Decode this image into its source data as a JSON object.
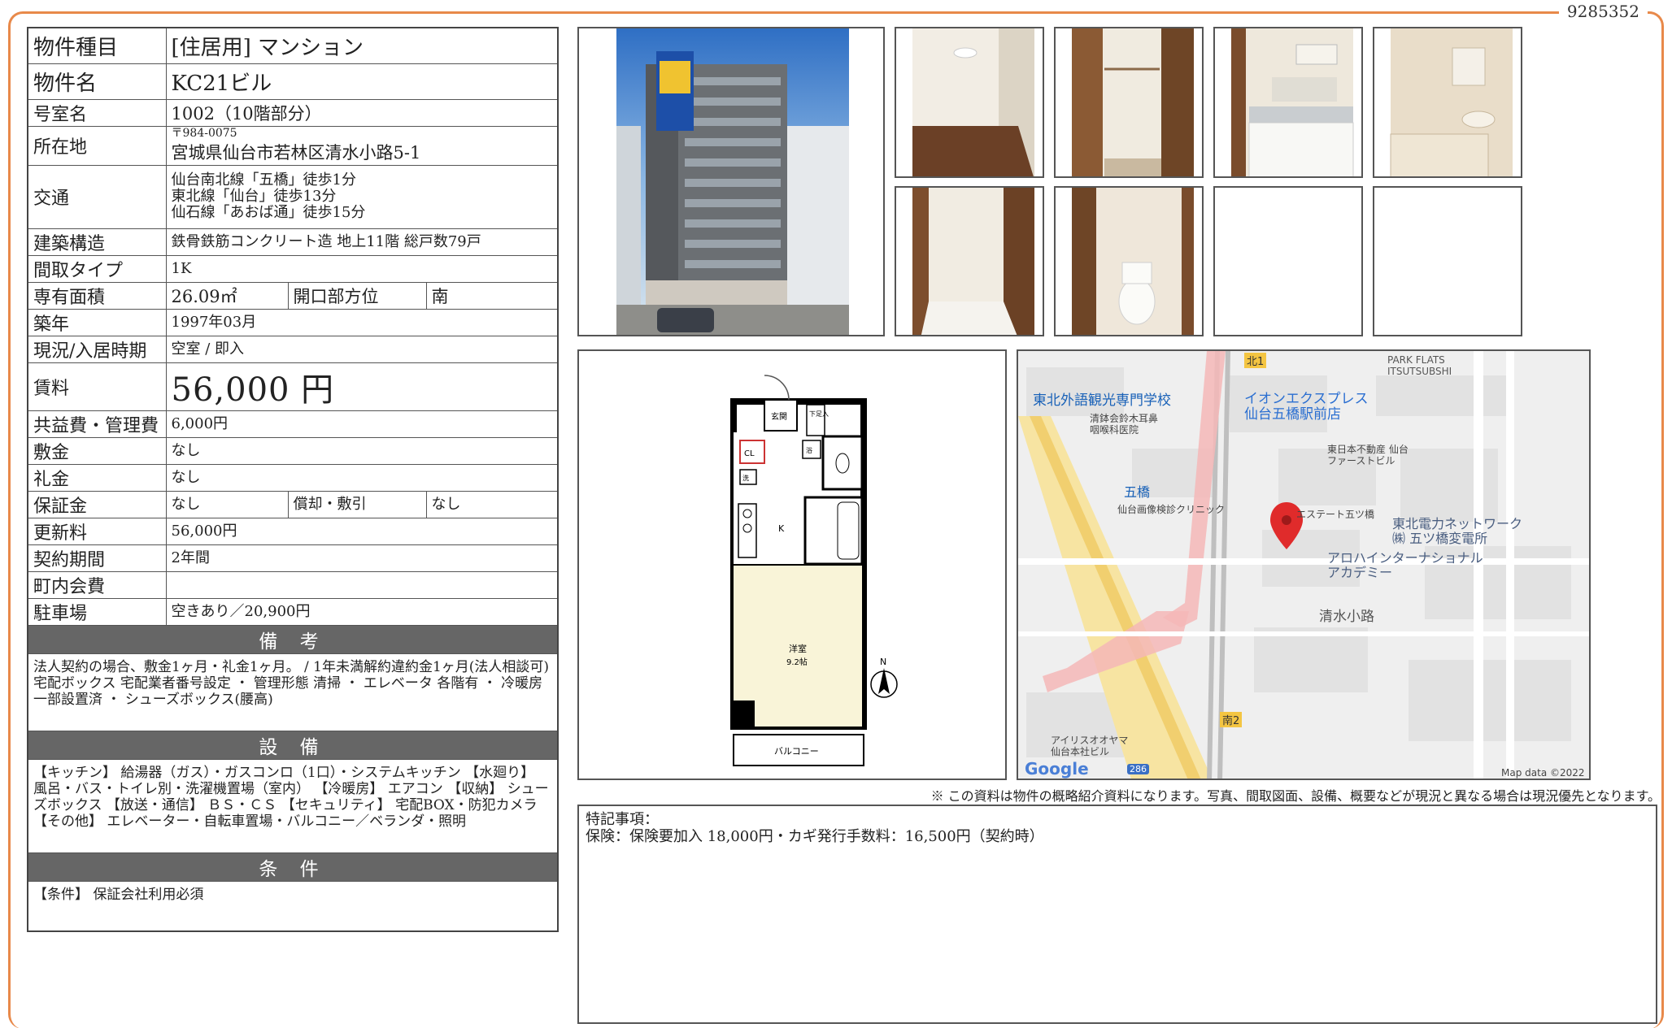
{
  "doc_number": "9285352",
  "property": {
    "type_label": "物件種目",
    "type_value": "[住居用] マンション",
    "name_label": "物件名",
    "name_value": "KC21ビル",
    "room_label": "号室名",
    "room_value": "1002（10階部分）",
    "address_label": "所在地",
    "postal": "〒984-0075",
    "address": "宮城県仙台市若林区清水小路5-1",
    "transport_label": "交通",
    "transport": [
      "仙台南北線「五橋」徒歩1分",
      "東北線「仙台」徒歩13分",
      "仙石線「あおば通」徒歩15分"
    ],
    "structure_label": "建築構造",
    "structure_value": "鉄骨鉄筋コンクリート造 地上11階 総戸数79戸",
    "layout_label": "間取タイプ",
    "layout_value": "1K",
    "area_label": "専有面積",
    "area_value": "26.09㎡",
    "direction_label": "開口部方位",
    "direction_value": "南",
    "built_label": "築年",
    "built_value": "1997年03月",
    "status_label": "現況/入居時期",
    "status_value": "空室 / 即入",
    "rent_label": "賃料",
    "rent_value": "56,000 円",
    "fee_label": "共益費・管理費",
    "fee_value": "6,000円",
    "deposit_label": "敷金",
    "deposit_value": "なし",
    "key_money_label": "礼金",
    "key_money_value": "なし",
    "guarantee_label": "保証金",
    "guarantee_value": "なし",
    "amort_label": "償却・敷引",
    "amort_value": "なし",
    "renewal_label": "更新料",
    "renewal_value": "56,000円",
    "contract_label": "契約期間",
    "contract_value": "2年間",
    "town_fee_label": "町内会費",
    "town_fee_value": "",
    "parking_label": "駐車場",
    "parking_value": "空きあり／20,900円"
  },
  "remarks": {
    "title": "備 考",
    "text": "法人契約の場合、敷金1ヶ月・礼金1ヶ月。 / 1年未満解約違約金1ヶ月(法人相談可)\n宅配ボックス 宅配業者番号設定 ・ 管理形態 清掃 ・ エレベータ 各階有 ・ 冷暖房 一部設置済 ・ シューズボックス(腰高)"
  },
  "facilities": {
    "title": "設 備",
    "text": "【キッチン】 給湯器（ガス）・ガスコンロ（1口）・システムキッチン 【水廻り】 風呂・バス・トイレ別・洗濯機置場（室内） 【冷暖房】 エアコン 【収納】 シューズボックス 【放送・通信】 ＢＳ・ＣＳ 【セキュリティ】 宅配BOX・防犯カメラ 【その他】 エレベーター・自転車置場・バルコニー／ベランダ・照明"
  },
  "conditions": {
    "title": "条 件",
    "text": "【条件】 保証会社利用必須"
  },
  "floorplan": {
    "entrance": "玄関",
    "storage": "下足入",
    "cl": "CL",
    "wash": "洗",
    "bath": "浴",
    "kitchen": "K",
    "room": "洋室",
    "room_size": "9.2帖",
    "balcony": "バルコニー",
    "north": "N"
  },
  "map": {
    "labels": {
      "school": "東北外語観光専門学校",
      "clinic1": "清鉢会鈴木耳鼻\n咽喉科医院",
      "aeon": "イオンエクスプレス\n仙台五橋駅前店",
      "estate": "東日本不動産 仙台\nファーストビル",
      "itsutsubashi": "五橋",
      "clinic2": "仙台画像検診クリニック",
      "estate2": "エステート五ツ橋",
      "tohoku": "東北電力ネットワーク\n㈱ 五ツ橋変電所",
      "academy": "アロハインターナショナル\nアカデミー",
      "shimizu": "清水小路",
      "park": "PARK FLATS\nITSUTSUBSHI",
      "iris": "アイリスオオヤマ\n仙台本社ビル",
      "kita1": "北1",
      "minami2": "南2",
      "route": "286",
      "google": "Google",
      "mapdata": "Map data ©2022"
    }
  },
  "disclaimer": "※ この資料は物件の概略紹介資料になります。写真、間取図面、設備、概要などが現況と異なる場合は現況優先となります。",
  "special": {
    "title": "特記事項：",
    "text": "保険：保険要加入 18,000円・カギ発行手数料：16,500円（契約時）"
  }
}
